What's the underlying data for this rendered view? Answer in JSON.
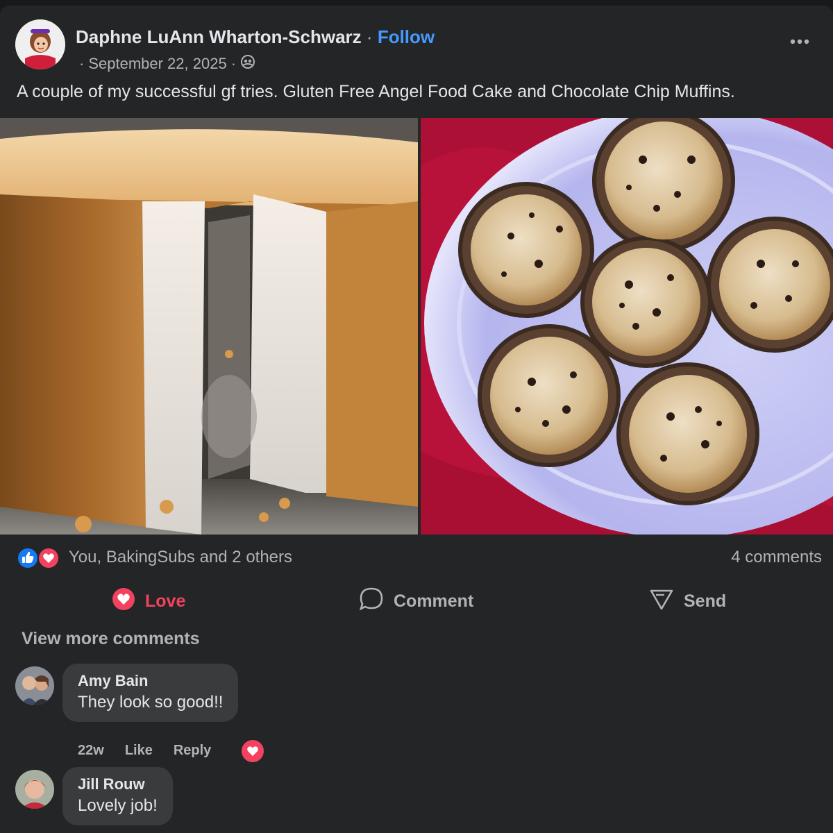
{
  "post": {
    "author": "Daphne LuAnn Wharton-Schwarz",
    "separator": "·",
    "follow_label": "Follow",
    "meta_prefix": "·",
    "date": "September 22, 2025",
    "meta_separator": "·",
    "audience_icon": "friends-icon",
    "more_icon": "more-options-icon",
    "text": "A couple of my successful gf tries. Gluten Free Angel Food Cake and Chocolate Chip Muffins."
  },
  "photos": [
    {
      "subject": "angel-food-cake-photo"
    },
    {
      "subject": "chocolate-chip-muffins-photo"
    }
  ],
  "reactions": {
    "icons": [
      "like-icon",
      "love-icon"
    ],
    "summary": "You, BakingSubs and 2 others",
    "comments_count": "4 comments"
  },
  "actions": {
    "love_label": "Love",
    "comment_label": "Comment",
    "send_label": "Send"
  },
  "comments_section": {
    "view_more_label": "View more comments",
    "comments": [
      {
        "author": "Amy Bain",
        "text": "They look so good!!",
        "age": "22w",
        "like_label": "Like",
        "reply_label": "Reply",
        "reaction": "love-icon"
      },
      {
        "author": "Jill Rouw",
        "text": "Lovely job!"
      }
    ]
  },
  "colors": {
    "background": "#18191a",
    "card": "#242526",
    "bubble": "#3a3b3c",
    "accent_blue": "#4599ff",
    "love_red": "#f3425f",
    "secondary_text": "#b0b3b8"
  }
}
